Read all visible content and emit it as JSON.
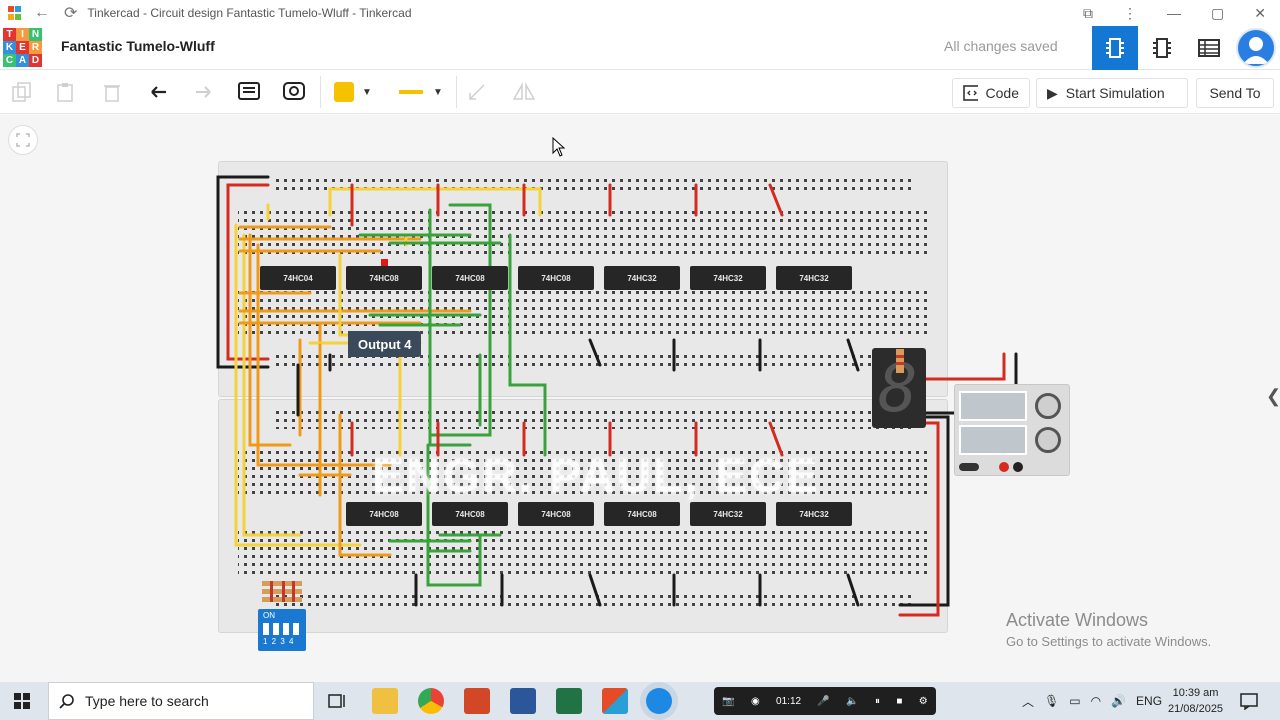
{
  "window": {
    "tab_title": "Tinkercad - Circuit design Fantastic Tumelo-Wluff - Tinkercad"
  },
  "header": {
    "logo_letters": [
      "T",
      "I",
      "N",
      "K",
      "E",
      "R",
      "C",
      "A",
      "D"
    ],
    "project_name": "Fantastic Tumelo-Wluff",
    "save_status": "All changes saved"
  },
  "toolbar": {
    "code_label": "Code",
    "start_simulation_label": "Start Simulation",
    "send_to_label": "Send To",
    "fill_color": "#f5c200",
    "wire_color": "#f5c200"
  },
  "canvas": {
    "tooltip": "Output 4",
    "watermark": "ENGR. PAUL, ECE",
    "top_board_chips": [
      "74HC04",
      "74HC08",
      "74HC08",
      "74HC08",
      "74HC32",
      "74HC32",
      "74HC32"
    ],
    "bottom_board_chips": [
      "74HC08",
      "74HC08",
      "74HC08",
      "74HC08",
      "74HC32",
      "74HC32"
    ],
    "dip_switch_label": "ON",
    "dip_switch_numbers": "1 2 3 4",
    "seven_segment_digit": "8"
  },
  "activation": {
    "line1": "Activate Windows",
    "line2": "Go to Settings to activate Windows."
  },
  "taskbar": {
    "search_placeholder": "Type here to search",
    "recording_time": "01:12",
    "language": "ENG",
    "time": "10:39 am",
    "date": "21/08/2025"
  },
  "colors": {
    "accent": "#1477d4",
    "wire_orange": "#f09a1a",
    "wire_yellow": "#f5d23a",
    "wire_green": "#3aa23a",
    "wire_red": "#d42a1f",
    "wire_black": "#1a1a1a"
  }
}
